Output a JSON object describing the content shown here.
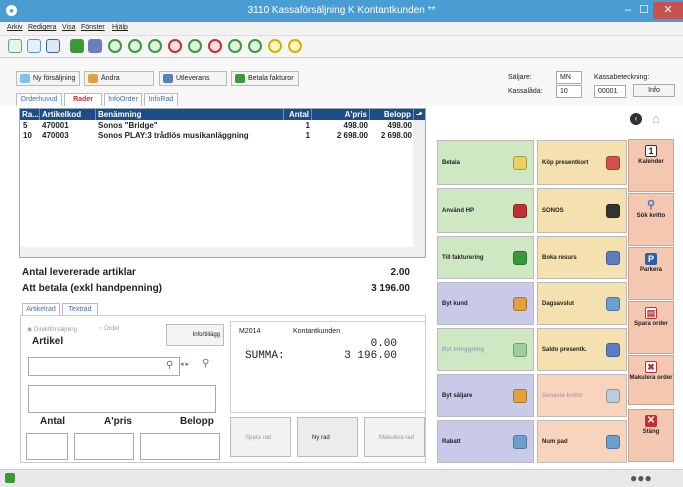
{
  "window": {
    "title": "3110 Kassaförsäljning  K  Kontantkunden **",
    "minimize": "–",
    "maximize": "☐",
    "close": "✕"
  },
  "menu": [
    "Arkiv",
    "Redigera",
    "Visa",
    "Fönster",
    "Hjälp"
  ],
  "actions": {
    "new_sale": "Ny försäljning",
    "edit": "Ändra",
    "deliver": "Utleverans",
    "pay_invoices": "Betala fakturor"
  },
  "tabs": [
    "Orderhuvud",
    "Rader",
    "InfoOrder",
    "InfoRad"
  ],
  "info": {
    "seller_label": "Säljare:",
    "seller_value": "MN",
    "register_label": "Kassalåda:",
    "register_value": "10",
    "cashier_label": "Kassabeteckning:",
    "cashier_value": "00001",
    "info_button": "Info"
  },
  "grid": {
    "headers": [
      "Ra...",
      "Artikelkod",
      "Benämning",
      "Antal",
      "A'pris",
      "Belopp",
      "⬏"
    ],
    "rows": [
      {
        "row": "5",
        "code": "470001",
        "name": "Sonos \"Bridge\"",
        "qty": "1",
        "price": "498.00",
        "amount": "498.00"
      },
      {
        "row": "10",
        "code": "470003",
        "name": "Sonos PLAY:3 trådlös musikanläggning",
        "qty": "1",
        "price": "2 698.00",
        "amount": "2 698.00"
      }
    ]
  },
  "summary": {
    "delivered_label": "Antal levererade artiklar",
    "delivered_value": "2.00",
    "pay_label": "Att betala  (exkl handpenning)",
    "pay_value": "3 196.00"
  },
  "lower_tabs": [
    "Artikelrad",
    "Textrad"
  ],
  "entry": {
    "direct_sale": "Direktförsäljning",
    "order": "Order",
    "info_button": "Info/tillägg",
    "article_label": "Artikel",
    "qty_label": "Antal",
    "price_label": "A'pris",
    "amount_label": "Belopp"
  },
  "display": {
    "code": "M2014",
    "customer": "Kontantkunden",
    "amount": "0.00",
    "sum_label": "SUMMA:",
    "sum_value": "3 196.00"
  },
  "bottom_buttons": {
    "save": "Spara rad",
    "new_row": "Ny rad",
    "cancel_row": "Makulera rad"
  },
  "grid_buttons": [
    {
      "label": "Betala",
      "color": "#cfe8c4"
    },
    {
      "label": "Köp presentkort",
      "color": "#f5e0b0"
    },
    {
      "label": "Använd HP",
      "color": "#cfe8c4"
    },
    {
      "label": "SONOS",
      "color": "#f5e0b0"
    },
    {
      "label": "Till fakturering",
      "color": "#cfe8c4"
    },
    {
      "label": "Boka resurs",
      "color": "#f5e0b0"
    },
    {
      "label": "Byt kund",
      "color": "#c9c9ea"
    },
    {
      "label": "Dagsavslut",
      "color": "#f5e0b0"
    },
    {
      "label": "Byt inloggning",
      "color": "#cfe8c4"
    },
    {
      "label": "Saldo presentk.",
      "color": "#f5e0b0"
    },
    {
      "label": "Byt säljare",
      "color": "#c9c9ea"
    },
    {
      "label": "Senaste kvitto",
      "color": "#f8d4bc"
    },
    {
      "label": "Rabatt",
      "color": "#c9c9ea"
    },
    {
      "label": "Num pad",
      "color": "#f8d4bc"
    }
  ],
  "right_buttons": [
    {
      "label": "Kalender",
      "icon": "calendar-icon",
      "glyph": "1"
    },
    {
      "label": "Sök kvitto",
      "icon": "search-receipt-icon",
      "glyph": "⚲"
    },
    {
      "label": "Parkera",
      "icon": "parking-icon",
      "glyph": "P"
    },
    {
      "label": "Spara order",
      "icon": "save-order-icon",
      "glyph": "▤"
    },
    {
      "label": "Makulera order",
      "icon": "cancel-order-icon",
      "glyph": "✖"
    },
    {
      "label": "Stäng",
      "icon": "close-icon",
      "glyph": "✕"
    }
  ]
}
